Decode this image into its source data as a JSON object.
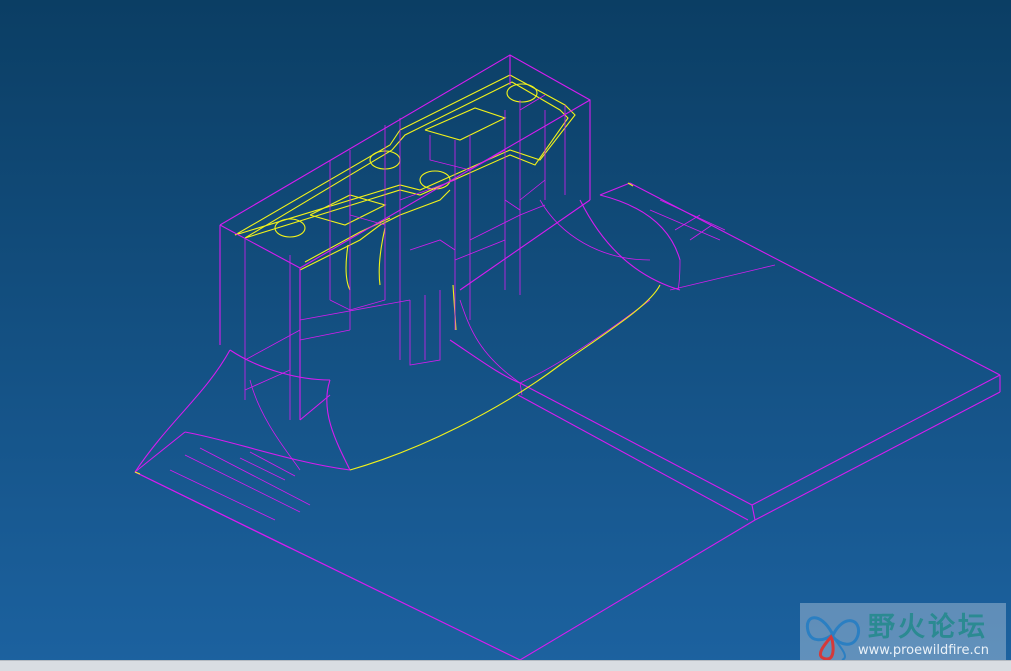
{
  "viewport": {
    "background_top": "#0b3e64",
    "background_bottom": "#1c62a0",
    "edge_color": "#d51cf0",
    "highlight_color": "#f2f21a"
  },
  "watermark": {
    "logo_icon": "butterfly-logo-icon",
    "title": "野火论坛",
    "url": "www.proewildfire.cn"
  }
}
